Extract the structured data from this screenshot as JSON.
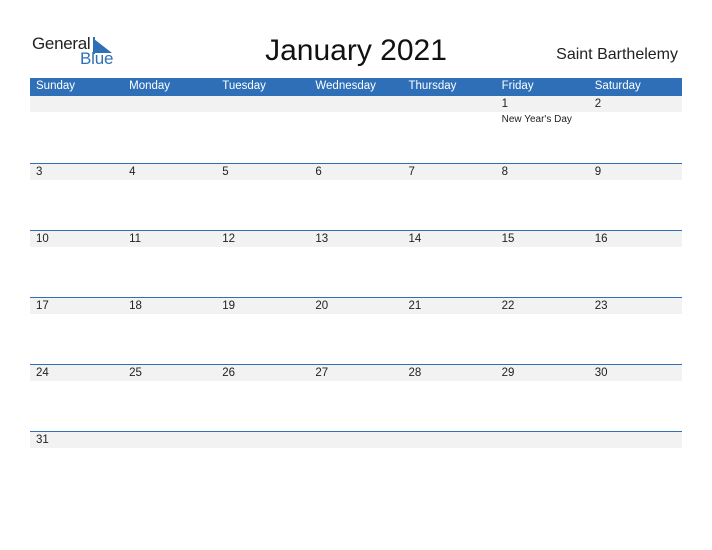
{
  "brand": {
    "line1": "General",
    "line2": "Blue",
    "accent": "#2e6fb7"
  },
  "title": "January 2021",
  "country": "Saint Barthelemy",
  "weekdays": [
    "Sunday",
    "Monday",
    "Tuesday",
    "Wednesday",
    "Thursday",
    "Friday",
    "Saturday"
  ],
  "weeks": [
    [
      {
        "day": ""
      },
      {
        "day": ""
      },
      {
        "day": ""
      },
      {
        "day": ""
      },
      {
        "day": ""
      },
      {
        "day": "1",
        "event": "New Year's Day"
      },
      {
        "day": "2"
      }
    ],
    [
      {
        "day": "3"
      },
      {
        "day": "4"
      },
      {
        "day": "5"
      },
      {
        "day": "6"
      },
      {
        "day": "7"
      },
      {
        "day": "8"
      },
      {
        "day": "9"
      }
    ],
    [
      {
        "day": "10"
      },
      {
        "day": "11"
      },
      {
        "day": "12"
      },
      {
        "day": "13"
      },
      {
        "day": "14"
      },
      {
        "day": "15"
      },
      {
        "day": "16"
      }
    ],
    [
      {
        "day": "17"
      },
      {
        "day": "18"
      },
      {
        "day": "19"
      },
      {
        "day": "20"
      },
      {
        "day": "21"
      },
      {
        "day": "22"
      },
      {
        "day": "23"
      }
    ],
    [
      {
        "day": "24"
      },
      {
        "day": "25"
      },
      {
        "day": "26"
      },
      {
        "day": "27"
      },
      {
        "day": "28"
      },
      {
        "day": "29"
      },
      {
        "day": "30"
      }
    ],
    [
      {
        "day": "31"
      },
      {
        "day": ""
      },
      {
        "day": ""
      },
      {
        "day": ""
      },
      {
        "day": ""
      },
      {
        "day": ""
      },
      {
        "day": ""
      }
    ]
  ]
}
